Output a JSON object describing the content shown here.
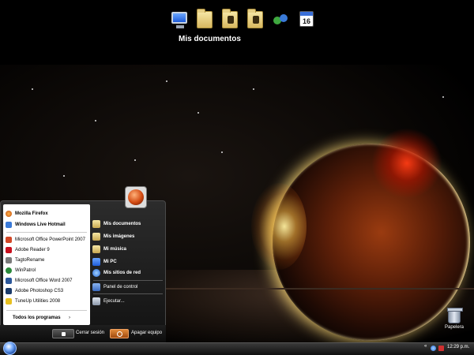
{
  "dock": {
    "icons": [
      "monitor-icon",
      "folder-icon",
      "folder-icon",
      "folder-icon",
      "people-icon",
      "calendar-icon"
    ],
    "calendar_day": "16",
    "label": "Mis documentos"
  },
  "start_menu": {
    "pinned": [
      "Mozilla Firefox",
      "Windows Live Hotmail"
    ],
    "recent": [
      "Microsoft Office PowerPoint 2007",
      "Adobe Reader 9",
      "TagtoRename",
      "WinPatrol",
      "Microsoft Office Word 2007",
      "Adobe Photoshop CS3",
      "TuneUp Utilities 2008"
    ],
    "all_programs": "Todos los programas",
    "all_programs_arrow": "›",
    "places": [
      "Mis documentos",
      "Mis imágenes",
      "Mi música",
      "Mi PC",
      "Mis sitios de red"
    ],
    "control_panel": "Panel de control",
    "run": "Ejecutar...",
    "logoff": "Cerrar sesión",
    "shutdown": "Apagar equipo"
  },
  "desktop": {
    "recycle_bin": "Papelera"
  },
  "taskbar": {
    "tray_arrow": "«",
    "clock": "12:29 p.m."
  },
  "colors": {
    "accent": "#e07a2a",
    "menu_bg": "#1e1e1e",
    "panel_bg": "#ffffff"
  }
}
